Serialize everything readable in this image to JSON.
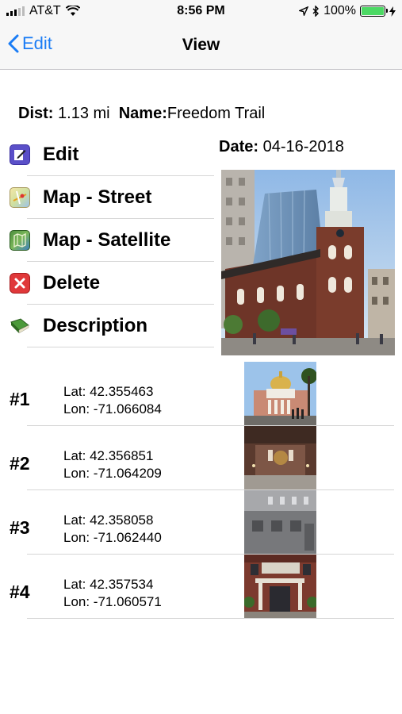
{
  "status_bar": {
    "carrier": "AT&T",
    "time": "8:56 PM",
    "battery": "100%",
    "battery_level": 1.0
  },
  "nav": {
    "back_label": "Edit",
    "title": "View"
  },
  "info": {
    "dist_label": "Dist:",
    "dist_value": "1.13 mi",
    "name_label": "Name:",
    "name_value": "Freedom Trail",
    "date_label": "Date:",
    "date_value": "04-16-2018"
  },
  "menu": [
    {
      "label": "Edit",
      "icon": "edit-icon"
    },
    {
      "label": "Map - Street",
      "icon": "street-map-icon"
    },
    {
      "label": "Map  - Satellite",
      "icon": "satellite-map-icon"
    },
    {
      "label": "Delete",
      "icon": "delete-icon"
    },
    {
      "label": "Description",
      "icon": "book-icon"
    }
  ],
  "waypoints": [
    {
      "num": "#1",
      "lat": "Lat: 42.355463",
      "lon": "Lon: -71.066084"
    },
    {
      "num": "#2",
      "lat": "Lat: 42.356851",
      "lon": "Lon: -71.064209"
    },
    {
      "num": "#3",
      "lat": "Lat: 42.358058",
      "lon": "Lon: -71.062440"
    },
    {
      "num": "#4",
      "lat": "Lat: 42.357534",
      "lon": "Lon: -71.060571"
    }
  ],
  "colors": {
    "accent": "#1a7cf5",
    "battery": "#4cd964"
  }
}
